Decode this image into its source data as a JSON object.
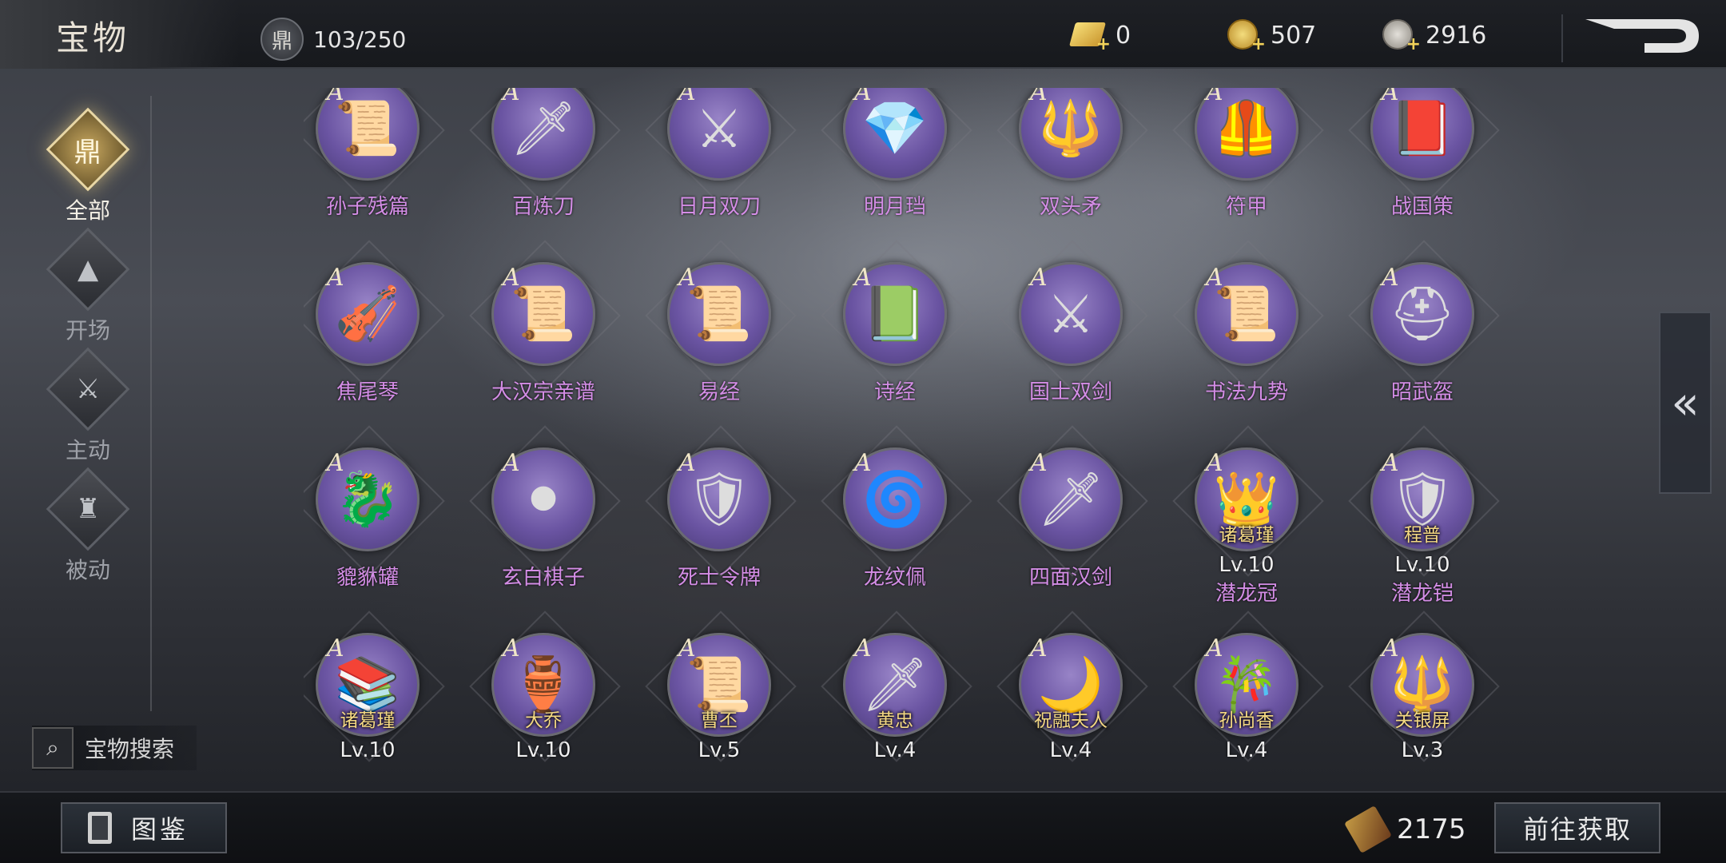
{
  "header": {
    "title": "宝物",
    "capacity": "103/250",
    "currencies": [
      {
        "name": "gold-bar",
        "value": "0"
      },
      {
        "name": "gold-coin",
        "value": "507"
      },
      {
        "name": "copper-coin",
        "value": "2916"
      }
    ]
  },
  "sidebar": {
    "items": [
      {
        "label": "全部",
        "icon": "ding-icon",
        "active": true
      },
      {
        "label": "开场",
        "icon": "pyramid-icon",
        "active": false
      },
      {
        "label": "主动",
        "icon": "sword-icon",
        "active": false
      },
      {
        "label": "被动",
        "icon": "armor-icon",
        "active": false
      }
    ],
    "search_label": "宝物搜索"
  },
  "grid": {
    "items": [
      {
        "grade": "A",
        "name": "孙子残篇",
        "icon": "scroll-bamboo-icon"
      },
      {
        "grade": "A",
        "name": "百炼刀",
        "icon": "blade-icon"
      },
      {
        "grade": "A",
        "name": "日月双刀",
        "icon": "twin-blade-icon"
      },
      {
        "grade": "A",
        "name": "明月珰",
        "icon": "earring-icon"
      },
      {
        "grade": "A",
        "name": "双头矛",
        "icon": "spear-icon"
      },
      {
        "grade": "A",
        "name": "符甲",
        "icon": "armor-vest-icon"
      },
      {
        "grade": "A",
        "name": "战国策",
        "icon": "book-icon"
      },
      {
        "grade": "A",
        "name": "焦尾琴",
        "icon": "zither-icon"
      },
      {
        "grade": "A",
        "name": "大汉宗亲谱",
        "icon": "genealogy-scroll-icon"
      },
      {
        "grade": "A",
        "name": "易经",
        "icon": "bamboo-slip-icon"
      },
      {
        "grade": "A",
        "name": "诗经",
        "icon": "green-book-icon"
      },
      {
        "grade": "A",
        "name": "国士双剑",
        "icon": "twin-sword-icon"
      },
      {
        "grade": "A",
        "name": "书法九势",
        "icon": "calligraphy-scroll-icon"
      },
      {
        "grade": "A",
        "name": "昭武盔",
        "icon": "helmet-icon"
      },
      {
        "grade": "A",
        "name": "貔貅罐",
        "icon": "pixiu-icon"
      },
      {
        "grade": "A",
        "name": "玄白棋子",
        "icon": "go-pieces-icon"
      },
      {
        "grade": "A",
        "name": "死士令牌",
        "icon": "token-icon"
      },
      {
        "grade": "A",
        "name": "龙纹佩",
        "icon": "pendant-icon"
      },
      {
        "grade": "A",
        "name": "四面汉剑",
        "icon": "han-sword-icon"
      },
      {
        "grade": "A",
        "name": "潜龙冠",
        "icon": "crown-icon",
        "owner": "诸葛瑾",
        "level": "Lv.10"
      },
      {
        "grade": "A",
        "name": "潜龙铠",
        "icon": "plate-armor-icon",
        "owner": "程普",
        "level": "Lv.10"
      },
      {
        "grade": "A",
        "name": "",
        "icon": "books-icon",
        "owner": "诸葛瑾",
        "level": "Lv.10"
      },
      {
        "grade": "A",
        "name": "",
        "icon": "vessel-icon",
        "owner": "大乔",
        "level": "Lv.10"
      },
      {
        "grade": "A",
        "name": "",
        "icon": "decree-icon",
        "owner": "曹丕",
        "level": "Lv.5"
      },
      {
        "grade": "A",
        "name": "",
        "icon": "dragon-sword-icon",
        "owner": "黄忠",
        "level": "Lv.4"
      },
      {
        "grade": "A",
        "name": "",
        "icon": "crescent-blade-icon",
        "owner": "祝融夫人",
        "level": "Lv.4"
      },
      {
        "grade": "A",
        "name": "",
        "icon": "flute-icon",
        "owner": "孙尚香",
        "level": "Lv.4"
      },
      {
        "grade": "A",
        "name": "",
        "icon": "halberd-icon",
        "owner": "关银屏",
        "level": "Lv.3"
      }
    ]
  },
  "footer": {
    "codex_label": "图鉴",
    "fragments": "2175",
    "go_label": "前往获取"
  }
}
